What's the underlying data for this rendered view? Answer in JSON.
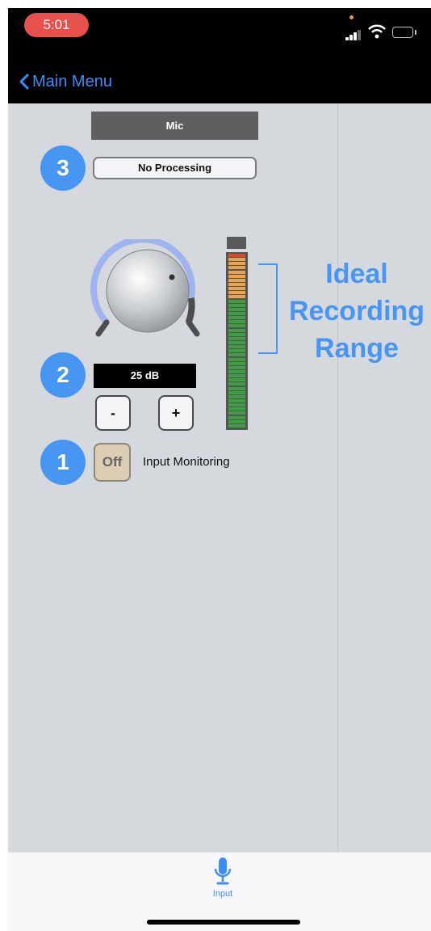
{
  "status_bar": {
    "time": "5:01"
  },
  "nav": {
    "back_label": "Main Menu"
  },
  "input_source": {
    "label": "Mic"
  },
  "processing": {
    "label": "No Processing"
  },
  "gain": {
    "display": "25 dB",
    "minus_label": "-",
    "plus_label": "+"
  },
  "monitoring": {
    "toggle_label": "Off",
    "label": "Input Monitoring"
  },
  "annotations": {
    "badges": [
      "3",
      "2",
      "1"
    ],
    "ideal_range_lines": [
      "Ideal",
      "Recording",
      "Range"
    ]
  },
  "tab_bar": {
    "tabs": [
      {
        "label": "Input",
        "icon": "microphone-icon"
      }
    ]
  },
  "colors": {
    "accent": "#4796f2",
    "ios_blue": "#3c8dfc",
    "status_time": "#e8514b",
    "meter_green": "#3f9e43",
    "meter_orange": "#e8a34f",
    "meter_red": "#d94a2b"
  }
}
